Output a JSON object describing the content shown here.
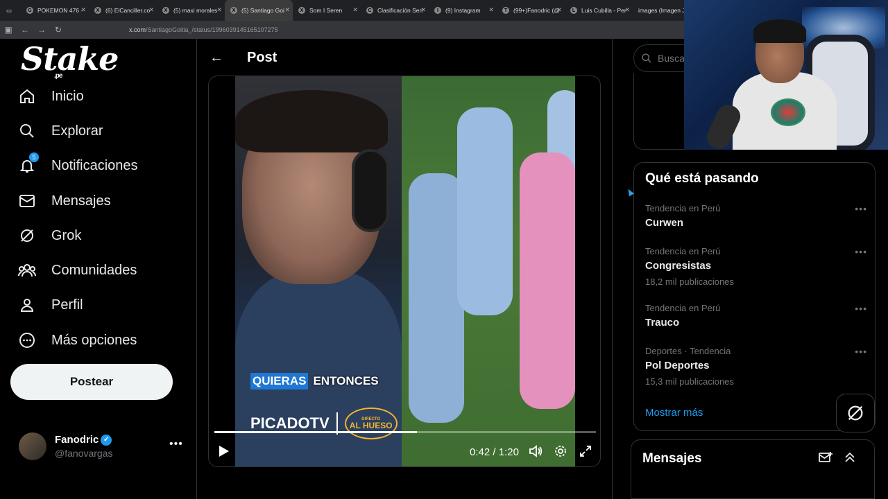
{
  "browser": {
    "tabs": [
      {
        "title": "POKEMON 476 -",
        "fav": "G",
        "active": false
      },
      {
        "title": "(6) ElCanciller.co",
        "fav": "X",
        "active": false
      },
      {
        "title": "(5) maxi morales",
        "fav": "X",
        "active": false
      },
      {
        "title": "(5) Santiago Goi",
        "fav": "X",
        "active": true
      },
      {
        "title": "Som I Seren",
        "fav": "X",
        "active": false
      },
      {
        "title": "Clasificación Seri",
        "fav": "C",
        "active": false
      },
      {
        "title": "(9) Instagram",
        "fav": "I",
        "active": false
      },
      {
        "title": "(99+)Fanodric (@",
        "fav": "T",
        "active": false
      },
      {
        "title": "Luis Cubilla - Per",
        "fav": "L",
        "active": false
      },
      {
        "title": "images (Imagen JPE",
        "fav": "",
        "active": false
      }
    ],
    "url_host": "x.com",
    "url_path": "/SantiagoGoitia_/status/1996039145165107275"
  },
  "sidebar": {
    "logo": "Stake",
    "logo_sub": ".pe",
    "items": [
      {
        "label": "Inicio",
        "icon": "home-icon"
      },
      {
        "label": "Explorar",
        "icon": "search-icon"
      },
      {
        "label": "Notificaciones",
        "icon": "bell-icon",
        "badge": "5"
      },
      {
        "label": "Mensajes",
        "icon": "mail-icon"
      },
      {
        "label": "Grok",
        "icon": "grok-icon"
      },
      {
        "label": "Comunidades",
        "icon": "communities-icon"
      },
      {
        "label": "Perfil",
        "icon": "person-icon"
      },
      {
        "label": "Más opciones",
        "icon": "more-circle-icon"
      }
    ],
    "post_button": "Postear",
    "account": {
      "name": "Fanodric",
      "handle": "@fanovargas"
    }
  },
  "main": {
    "title": "Post",
    "video": {
      "caption_words": [
        "QUIERAS",
        "ENTONCES"
      ],
      "brand": "PICADOTV",
      "logo_top": "DIRECTO",
      "logo_main": "AL HUESO",
      "current_time": "0:42",
      "duration": "1:20",
      "progress": 0.53
    }
  },
  "right": {
    "search_placeholder": "Busca",
    "trends_title": "Qué está pasando",
    "trends": [
      {
        "category": "Tendencia en Perú",
        "title": "Curwen",
        "count": ""
      },
      {
        "category": "Tendencia en Perú",
        "title": "Congresistas",
        "count": "18,2 mil publicaciones"
      },
      {
        "category": "Tendencia en Perú",
        "title": "Trauco",
        "count": ""
      },
      {
        "category": "Deportes · Tendencia",
        "title": "Pol Deportes",
        "count": "15,3 mil publicaciones"
      }
    ],
    "show_more": "Mostrar más",
    "messages_title": "Mensajes"
  },
  "colors": {
    "accent": "#1d9bf0",
    "bg": "#000000",
    "border": "#2f3336"
  }
}
